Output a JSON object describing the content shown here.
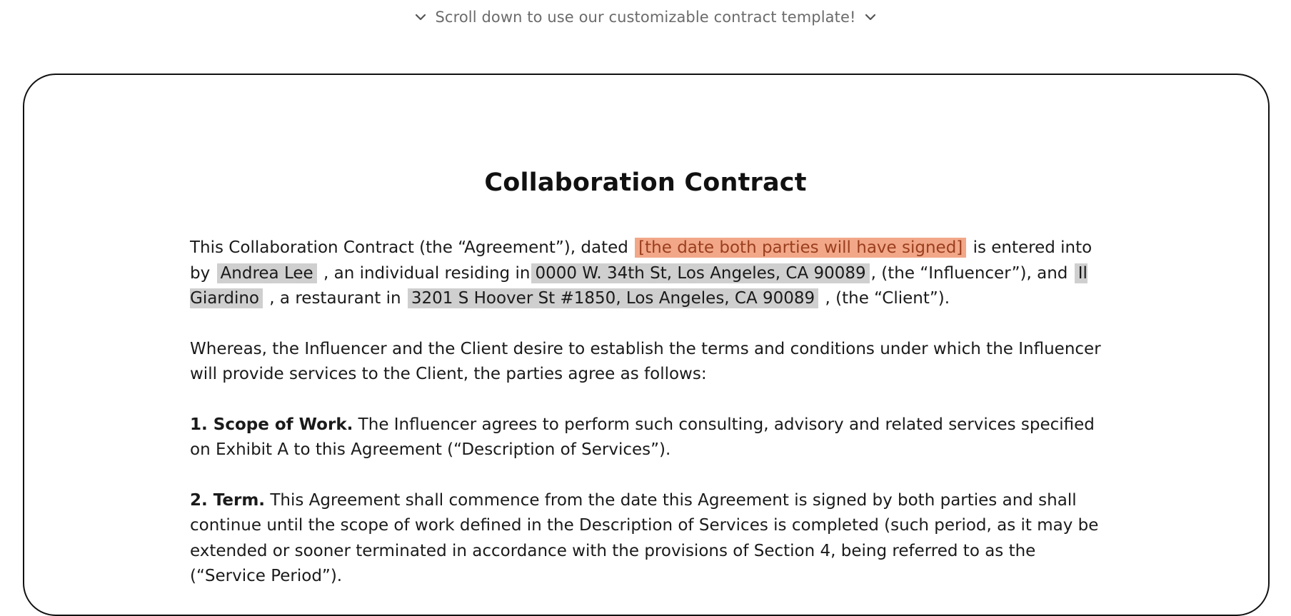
{
  "scroll_hint": {
    "text": "Scroll down to use our customizable contract template!",
    "left_icon": "chevron-down-icon",
    "right_icon": "chevron-down-icon"
  },
  "document": {
    "title": "Collaboration Contract",
    "intro": {
      "t1": "This Collaboration Contract (the “Agreement”), dated ",
      "date_field": "[the date both parties will have signed]",
      "t2": " is entered into by ",
      "influencer_name": "Andrea Lee",
      "t3": " , an individual residing in",
      "influencer_address": "0000 W. 34th St, Los Angeles, CA 90089",
      "t4": ", (the “Influencer”), and ",
      "client_name": "Il Giardino",
      "t5": " , a restaurant in ",
      "client_address": "3201 S Hoover St #1850, Los Angeles, CA 90089",
      "t6": " , (the “Client”)."
    },
    "whereas": "Whereas, the Influencer and the Client desire to establish the terms and conditions under which the Influencer will provide services to the Client, the parties agree as follows:",
    "section1": {
      "heading": "1. Scope of Work.",
      "text": " The Influencer agrees to perform such consulting, advisory and related services specified on Exhibit A to this Agreement (“Description of Services”)."
    },
    "section2": {
      "heading": "2. Term.",
      "text": " This Agreement shall commence from the date this Agreement is signed by both parties and shall continue until the scope of work defined in the Description of Services is completed (such period, as it may be extended or sooner terminated in accordance with the provisions of Section 4, being referred to as the (“Service Period”)."
    }
  },
  "colors": {
    "highlight_field": "#cfcfcf",
    "highlight_date_bg": "#f2a888",
    "highlight_date_text": "#9a3e1e",
    "border": "#111111",
    "hint_text": "#6b6b6b"
  }
}
